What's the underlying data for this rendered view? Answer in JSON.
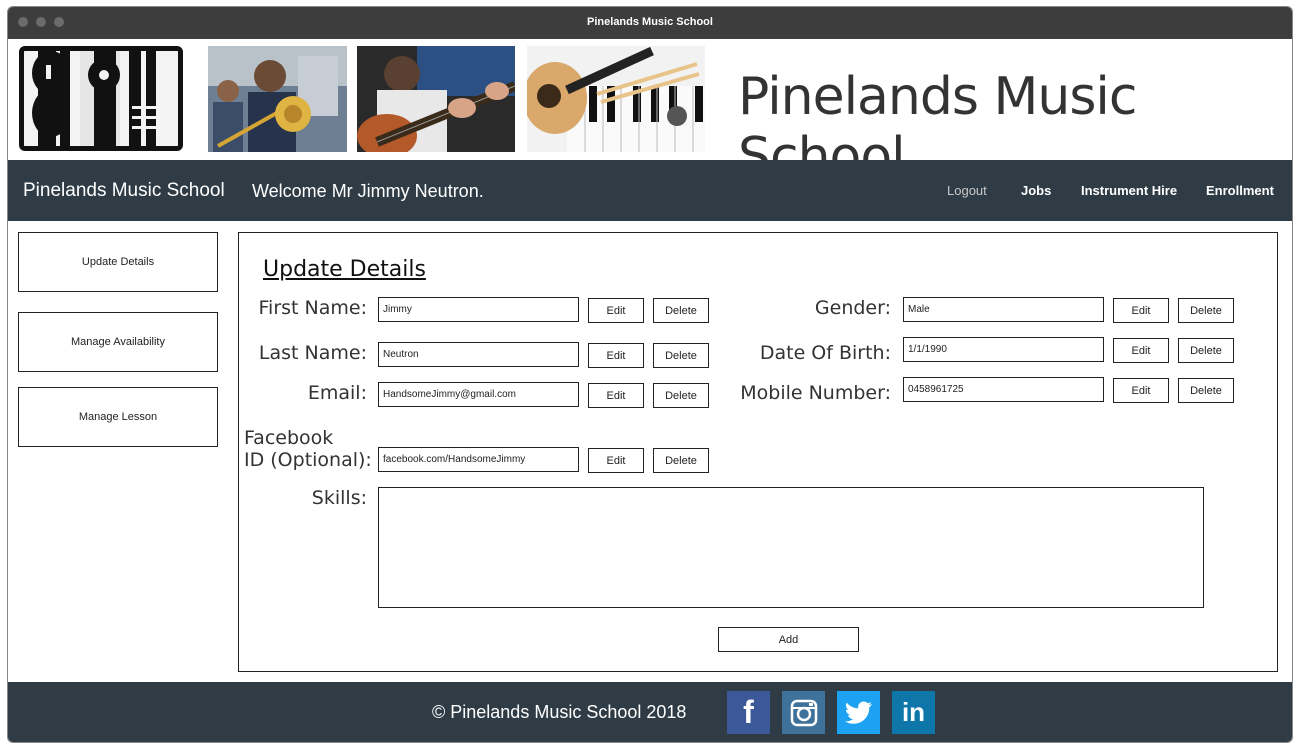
{
  "window": {
    "title": "Pinelands Music School"
  },
  "banner": {
    "title": "Pinelands Music School"
  },
  "navbar": {
    "brand": "Pinelands Music School",
    "welcome": "Welcome Mr Jimmy Neutron.",
    "links": [
      "Logout",
      "Jobs",
      "Instrument Hire",
      "Enrollment"
    ]
  },
  "sidebar": {
    "items": [
      {
        "label": "Update Details"
      },
      {
        "label": "Manage Availability"
      },
      {
        "label": "Manage Lesson"
      }
    ]
  },
  "form": {
    "title": "Update Details",
    "edit_label": "Edit",
    "delete_label": "Delete",
    "add_label": "Add",
    "first_name": {
      "label": "First Name:",
      "value": "Jimmy"
    },
    "last_name": {
      "label": "Last Name:",
      "value": "Neutron"
    },
    "email": {
      "label": "Email:",
      "value": "HandsomeJimmy@gmail.com"
    },
    "facebook": {
      "label_line1": "Facebook",
      "label_line2": "ID (Optional):",
      "value": "facebook.com/HandsomeJimmy"
    },
    "skills": {
      "label": "Skills:",
      "value": ""
    },
    "gender": {
      "label": "Gender:",
      "value": "Male"
    },
    "dob": {
      "label": "Date Of Birth:",
      "value": "1/1/1990"
    },
    "mobile": {
      "label": "Mobile Number:",
      "value": "0458961725"
    }
  },
  "footer": {
    "copyright": "© Pinelands Music School   2018",
    "social": [
      {
        "icon": "facebook-icon",
        "glyph": "f",
        "color": "#3b5998"
      },
      {
        "icon": "instagram-icon",
        "glyph": "◙",
        "color": "#3f729b"
      },
      {
        "icon": "twitter-icon",
        "glyph": "🐦",
        "color": "#1da1f2"
      },
      {
        "icon": "linkedin-icon",
        "glyph": "in",
        "color": "#0e76a8"
      }
    ]
  },
  "colors": {
    "navbar": "#2f3c45",
    "titlebar": "#3d3d3d"
  }
}
